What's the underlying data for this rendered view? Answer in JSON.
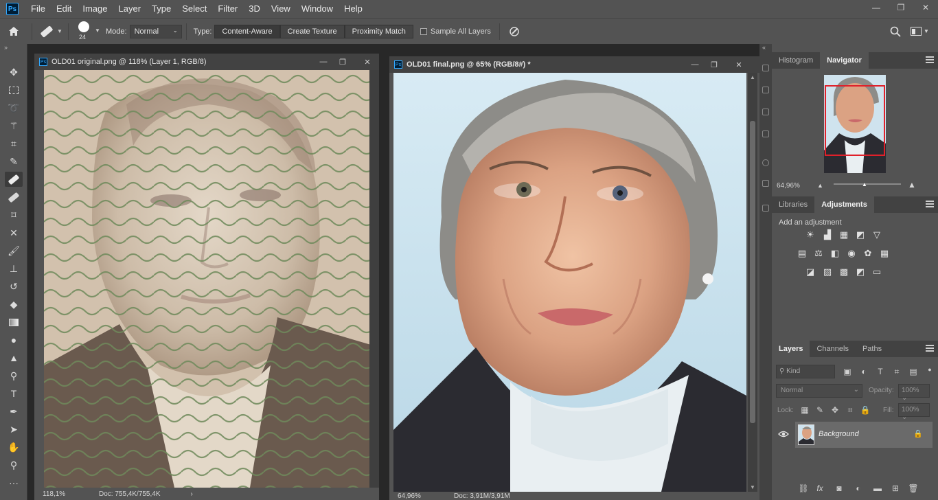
{
  "app": {
    "logo": "Ps"
  },
  "menu": [
    "File",
    "Edit",
    "Image",
    "Layer",
    "Type",
    "Select",
    "Filter",
    "3D",
    "View",
    "Window",
    "Help"
  ],
  "window_controls": {
    "minimize": "—",
    "restore": "❐",
    "close": "✕"
  },
  "options": {
    "brush_size": "24",
    "mode_label": "Mode:",
    "mode_value": "Normal",
    "type_label": "Type:",
    "types": [
      "Content-Aware",
      "Create Texture",
      "Proximity Match"
    ],
    "sample_all_layers": "Sample All Layers"
  },
  "tools": [
    "move-tool",
    "rectangular-marquee-tool",
    "lasso-tool",
    "magic-wand-tool",
    "crop-tool",
    "eyedropper-tool",
    "spot-healing-brush-tool",
    "patch-tool",
    "frame-tool",
    "content-aware-move-tool",
    "brush-tool",
    "clone-stamp-tool",
    "history-brush-tool",
    "eraser-tool",
    "gradient-tool",
    "blur-tool",
    "sharpen-tool",
    "dodge-tool",
    "type-tool",
    "pen-tool",
    "path-selection-tool",
    "hand-tool",
    "zoom-tool",
    "more-tools"
  ],
  "doc1": {
    "title": "OLD01 original.png @ 118% (Layer 1, RGB/8)",
    "zoom": "118,1%",
    "doc_info": "Doc: 755,4K/755,4K"
  },
  "doc2": {
    "title": "OLD01 final.png @ 65% (RGB/8#) *",
    "zoom": "64,96%",
    "doc_info": "Doc: 3,91M/3,91M"
  },
  "navigator": {
    "tabs": [
      "Histogram",
      "Navigator"
    ],
    "zoom": "64,96%"
  },
  "adjustments": {
    "tabs": [
      "Libraries",
      "Adjustments"
    ],
    "add_label": "Add an adjustment",
    "icons_row1": [
      "brightness-contrast-icon",
      "levels-icon",
      "curves-icon",
      "exposure-icon",
      "vibrance-icon"
    ],
    "icons_row2": [
      "hue-saturation-icon",
      "color-balance-icon",
      "black-white-icon",
      "photo-filter-icon",
      "channel-mixer-icon",
      "color-lookup-icon"
    ],
    "icons_row3": [
      "invert-icon",
      "posterize-icon",
      "threshold-icon",
      "selective-color-icon",
      "gradient-map-icon"
    ]
  },
  "layers": {
    "tabs": [
      "Layers",
      "Channels",
      "Paths"
    ],
    "kind": "Kind",
    "blend": "Normal",
    "opacity_label": "Opacity:",
    "opacity": "100%",
    "lock_label": "Lock:",
    "fill_label": "Fill:",
    "fill": "100%",
    "layer_name": "Background"
  }
}
